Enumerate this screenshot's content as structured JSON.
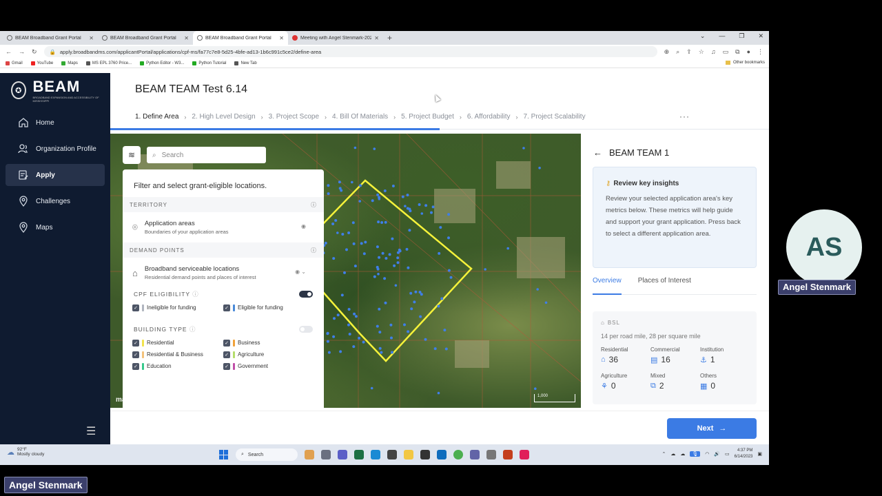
{
  "browser": {
    "tabs": [
      {
        "title": "BEAM Broadband Grant Portal",
        "active": false
      },
      {
        "title": "BEAM Broadband Grant Portal",
        "active": false
      },
      {
        "title": "BEAM Broadband Grant Portal",
        "active": true
      },
      {
        "title": "Meeting with Angel Stenmark-2023...",
        "active": false
      }
    ],
    "new_tab": "+",
    "url": "apply.broadbandms.com/applicantPortal/applications/cpf-ms/fa77c7e8-5d25-4bfe-ad13-1b6c991c5ce2/define-area",
    "bookmarks": [
      "Gmail",
      "YouTube",
      "Maps",
      "MS EPL 3760 Price...",
      "Python Editor - W3...",
      "Python Tutorial",
      "New Tab"
    ],
    "other_bookmarks": "Other bookmarks"
  },
  "sidebar": {
    "logo": "BEAM",
    "logo_sub": "BROADBAND EXPANSION AND ACCESSIBILITY OF MISSISSIPPI",
    "items": [
      {
        "label": "Home",
        "active": false
      },
      {
        "label": "Organization Profile",
        "active": false
      },
      {
        "label": "Apply",
        "active": true
      },
      {
        "label": "Challenges",
        "active": false
      },
      {
        "label": "Maps",
        "active": false
      }
    ]
  },
  "header": {
    "title": "BEAM TEAM Test 6.14",
    "steps": [
      "1. Define Area",
      "2. High Level Design",
      "3. Project Scope",
      "4. Bill Of Materials",
      "5. Project Budget",
      "6. Affordability",
      "7. Project Scalability"
    ],
    "more": "···"
  },
  "map": {
    "search_placeholder": "Search",
    "mapbox": "mapbox",
    "scale": "1,000"
  },
  "filter": {
    "heading": "Filter and select grant-eligible locations.",
    "territory_label": "TERRITORY",
    "application_areas_title": "Application areas",
    "application_areas_sub": "Boundaries of your application areas",
    "demand_label": "DEMAND POINTS",
    "bsl_title": "Broadband serviceable locations",
    "bsl_sub": "Residential demand points and places of interest",
    "cpf_label": "CPF ELIGIBILITY",
    "cpf_items": [
      {
        "label": "Ineligible for funding",
        "color": "#b0b5bf"
      },
      {
        "label": "Eligible for funding",
        "color": "#4a8ad8"
      }
    ],
    "building_label": "BUILDING TYPE",
    "building_items": [
      {
        "label": "Residential",
        "color": "#f2e34c"
      },
      {
        "label": "Business",
        "color": "#f0a13a"
      },
      {
        "label": "Residential & Business",
        "color": "#f4c27a"
      },
      {
        "label": "Agriculture",
        "color": "#b5dd6b"
      },
      {
        "label": "Education",
        "color": "#37c98b"
      },
      {
        "label": "Government",
        "color": "#c04fa8"
      }
    ]
  },
  "right_panel": {
    "title": "BEAM TEAM 1",
    "insight_title": "Review key insights",
    "insight_text": "Review your selected application area's key metrics below. These metrics will help guide and support your grant application. Press back to select a different application area.",
    "tabs": [
      "Overview",
      "Places of Interest"
    ],
    "bsl_heading": "BSL",
    "bsl_sub": "14 per road mile, 28 per square mile",
    "metrics": [
      {
        "label": "Residential",
        "value": "36"
      },
      {
        "label": "Commercial",
        "value": "16"
      },
      {
        "label": "Institution",
        "value": "1"
      },
      {
        "label": "Agriculture",
        "value": "0"
      },
      {
        "label": "Mixed",
        "value": "2"
      },
      {
        "label": "Others",
        "value": "0"
      }
    ]
  },
  "footer": {
    "next_label": "Next"
  },
  "taskbar": {
    "weather_temp": "92°F",
    "weather_desc": "Mostly cloudy",
    "search_label": "Search",
    "time": "4:37 PM",
    "date": "6/14/2023"
  },
  "meeting": {
    "initials": "AS",
    "participant_name": "Angel Stenmark",
    "self_name": "Angel Stenmark"
  },
  "colors": {
    "accent": "#3b7be4",
    "sidebar_bg": "#0f1b30",
    "polygon": "#f5f23a"
  }
}
